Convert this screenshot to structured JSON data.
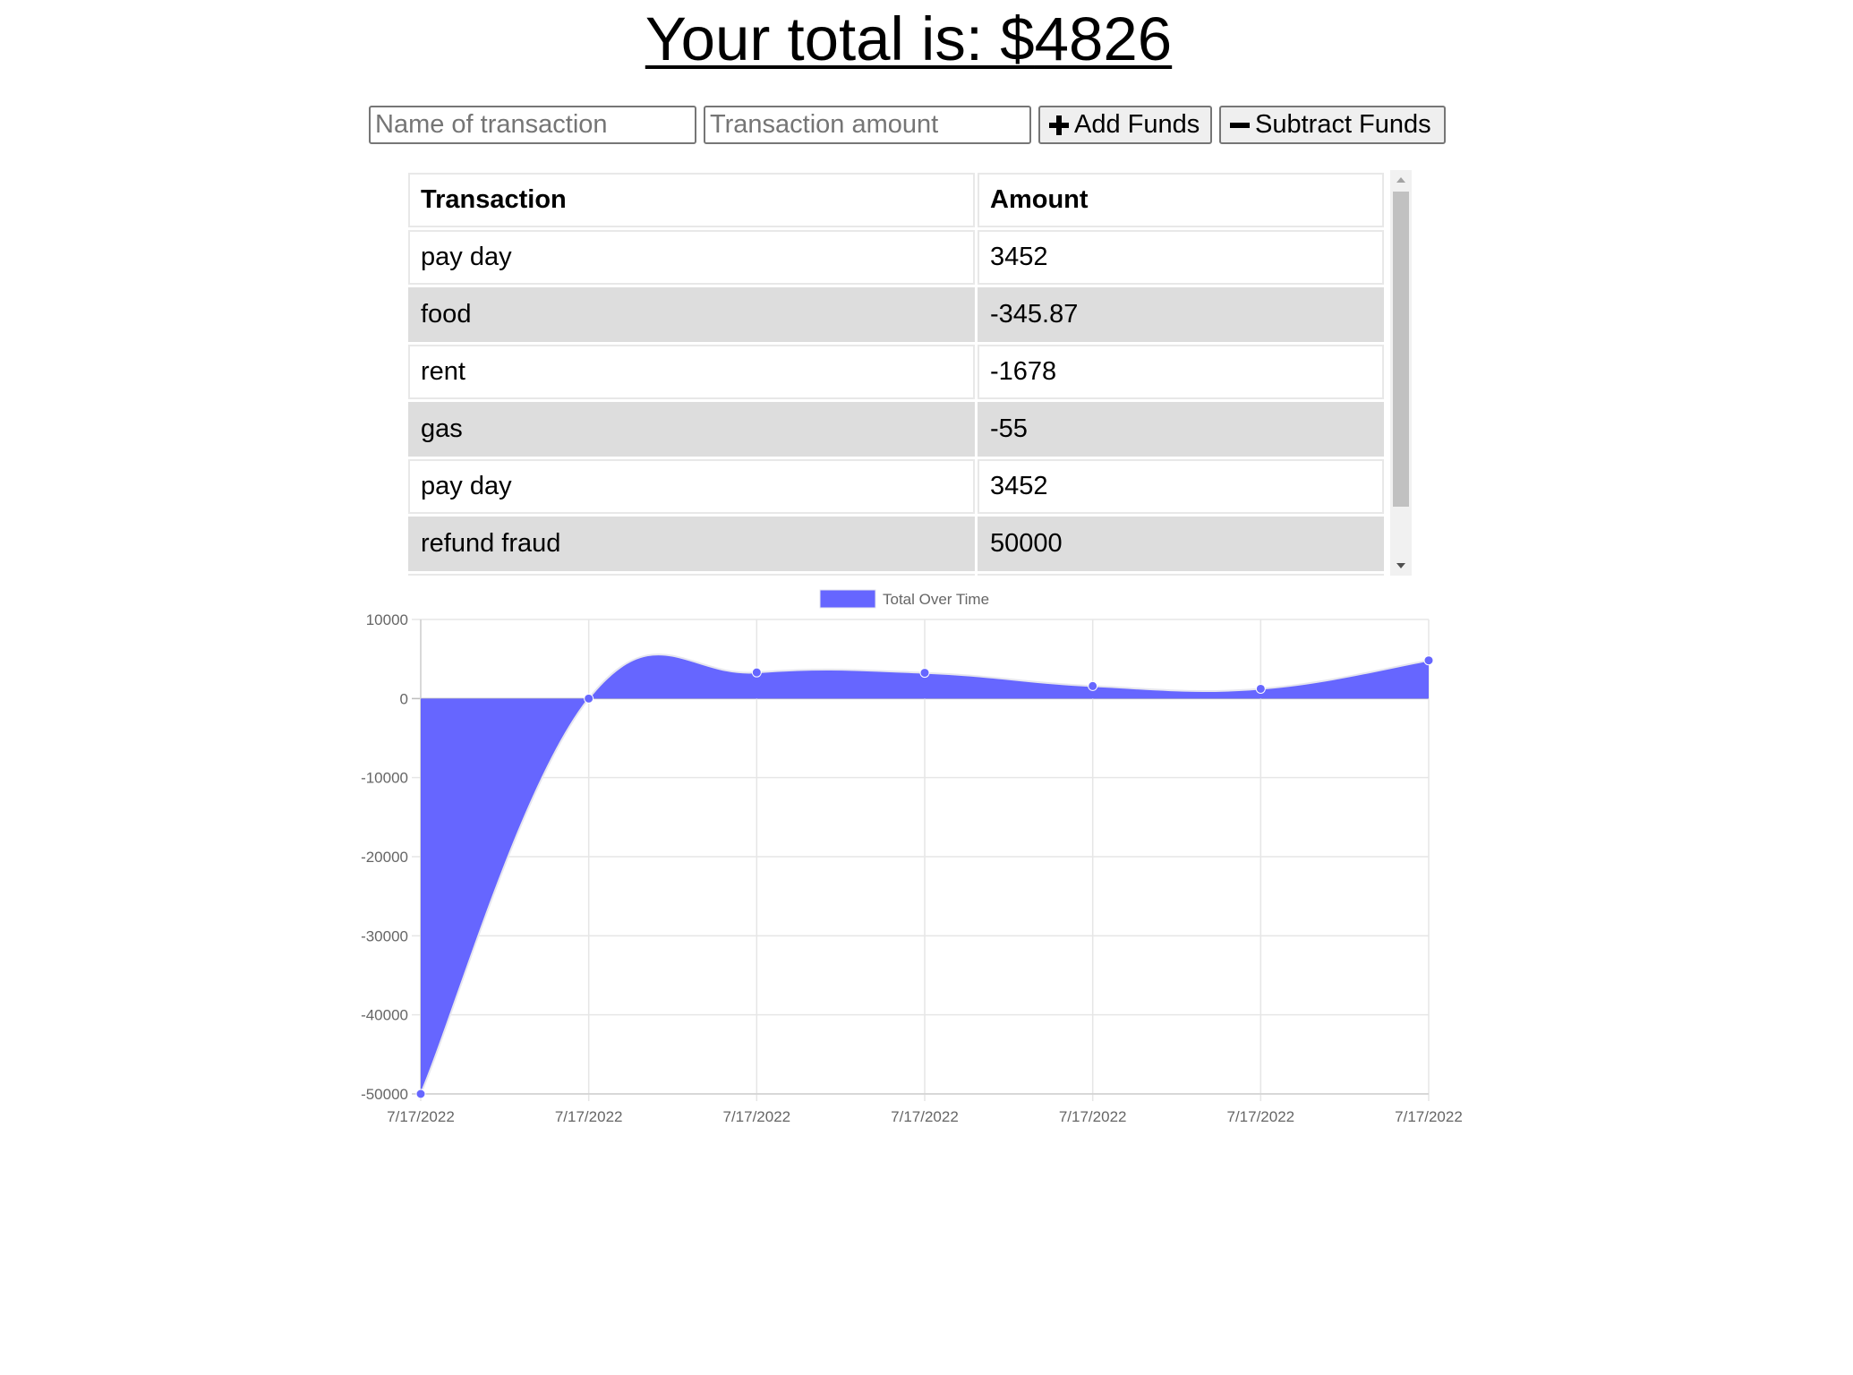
{
  "header": {
    "total_label": "Your total is: $",
    "total_value": "4826"
  },
  "form": {
    "name_placeholder": "Name of transaction",
    "amount_placeholder": "Transaction amount",
    "add_label": "Add Funds",
    "subtract_label": "Subtract Funds"
  },
  "table": {
    "columns": [
      "Transaction",
      "Amount"
    ],
    "rows": [
      {
        "name": "pay day",
        "amount": "3452"
      },
      {
        "name": "food",
        "amount": "-345.87"
      },
      {
        "name": "rent",
        "amount": "-1678"
      },
      {
        "name": "gas",
        "amount": "-55"
      },
      {
        "name": "pay day",
        "amount": "3452"
      },
      {
        "name": "refund fraud",
        "amount": "50000"
      }
    ]
  },
  "chart_data": {
    "type": "area",
    "x": [
      "7/17/2022",
      "7/17/2022",
      "7/17/2022",
      "7/17/2022",
      "7/17/2022",
      "7/17/2022",
      "7/17/2022"
    ],
    "series": [
      {
        "name": "Total Over Time",
        "values": [
          -50000,
          0,
          3300,
          3255,
          1577,
          1231,
          4826
        ],
        "color": "#6666ff"
      }
    ],
    "ylim": [
      -50000,
      10000
    ],
    "yticks": [
      10000,
      0,
      -10000,
      -20000,
      -30000,
      -40000,
      -50000
    ],
    "grid": true,
    "legend": "top-center"
  }
}
